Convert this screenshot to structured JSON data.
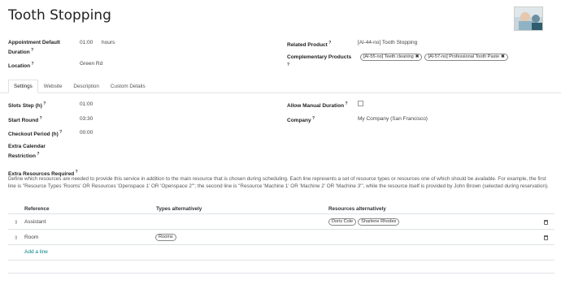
{
  "title": "Tooth Stopping",
  "fields": {
    "duration_label": "Appointment Default Duration",
    "duration_value": "01:00",
    "duration_unit": "hours",
    "location_label": "Location",
    "location_value": "Green Rd",
    "related_product_label": "Related Product",
    "related_product_value": "[Al-44-no] Tooth Stopping",
    "complementary_label": "Complementary Products",
    "complementary_tags": [
      "[Al-55-no] Teeth cleaning",
      "[Al-57-no] Professional Tooth Paste"
    ]
  },
  "tabs": [
    "Settings",
    "Website",
    "Description",
    "Custom Details"
  ],
  "settings": {
    "slots_step_label": "Slots Step (h)",
    "slots_step_value": "01:00",
    "start_round_label": "Start Round",
    "start_round_value": "03:30",
    "checkout_label": "Checkout Period (h)",
    "checkout_value": "00:00",
    "extra_calendar_label": "Extra Calendar Restriction",
    "manual_duration_label": "Allow Manual Duration",
    "manual_duration_checked": false,
    "company_label": "Company",
    "company_value": "My Company (San Francisco)"
  },
  "extra_resources": {
    "label": "Extra Resources Required",
    "description": "Define which resources are needed to provide this service in addition to the main resource that is chosen during scheduling. Each line represents a set of resource types or resources one of which should be available. For example, the first line is \"Resource Types 'Rooms' OR Resources 'Openspace 1' OR 'Openspace 2'\"; the second line is \"Resource 'Machine 1' OR 'Machine 2' OR 'Machine 3'\", while the resource itself is provided by John Brown (selected during reservation).",
    "columns": [
      "Reference",
      "Types alternatively",
      "Resources alternatively"
    ],
    "rows": [
      {
        "reference": "Assistant",
        "types": [],
        "resources": [
          "Doris Cole",
          "Sharlene Rhodes"
        ]
      },
      {
        "reference": "Room",
        "types": [
          "Rooms"
        ],
        "resources": []
      }
    ],
    "add_line": "Add a line"
  },
  "icons": {
    "drag": "drag-handle-icon",
    "trash": "trash-icon",
    "avatar": "product-image"
  }
}
